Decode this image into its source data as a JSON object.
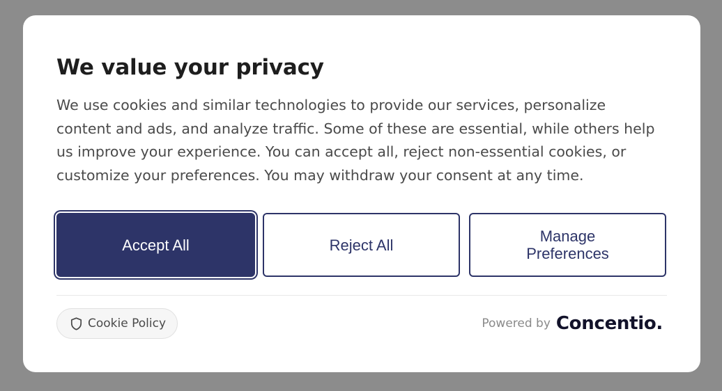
{
  "dialog": {
    "title": "We value your privacy",
    "description": "We use cookies and similar technologies to provide our services, personalize content and ads, and analyze traffic. Some of these are essential, while others help us improve your experience. You can accept all, reject non-essential cookies, or customize your preferences. You may withdraw your consent at any time."
  },
  "buttons": {
    "accept_label": "Accept All",
    "reject_label": "Reject All",
    "manage_label": "Manage\nPreferences"
  },
  "footer": {
    "policy_icon": "shield-icon",
    "policy_label": "Cookie Policy",
    "powered_label": "Powered by",
    "brand_name": "Concentio."
  },
  "colors": {
    "overlay": "#8c8c8c",
    "primary": "#2d3468",
    "title_text": "#1e1e1e",
    "body_text": "#4a4a4a",
    "brand_text": "#12122a"
  }
}
